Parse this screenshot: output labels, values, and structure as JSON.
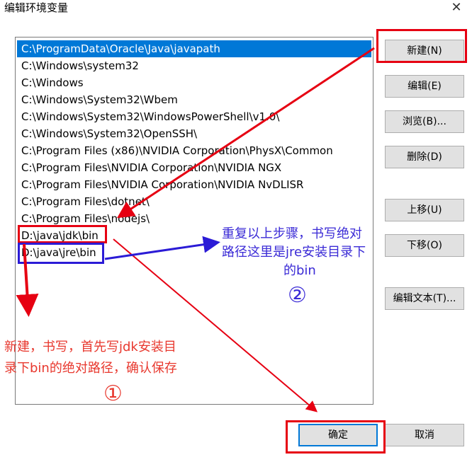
{
  "window": {
    "title": "编辑环境变量",
    "close_glyph": "✕"
  },
  "paths": [
    "C:\\ProgramData\\Oracle\\Java\\javapath",
    "C:\\Windows\\system32",
    "C:\\Windows",
    "C:\\Windows\\System32\\Wbem",
    "C:\\Windows\\System32\\WindowsPowerShell\\v1.0\\",
    "C:\\Windows\\System32\\OpenSSH\\",
    "C:\\Program Files (x86)\\NVIDIA Corporation\\PhysX\\Common",
    "C:\\Program Files\\NVIDIA Corporation\\NVIDIA NGX",
    "C:\\Program Files\\NVIDIA Corporation\\NVIDIA NvDLISR",
    "C:\\Program Files\\dotnet\\",
    "C:\\Program Files\\nodejs\\",
    "D:\\java\\jdk\\bin",
    "D:\\java\\jre\\bin"
  ],
  "selected_index": 0,
  "buttons": {
    "new": "新建(N)",
    "edit": "编辑(E)",
    "browse": "浏览(B)...",
    "delete": "删除(D)",
    "move_up": "上移(U)",
    "move_down": "下移(O)",
    "edit_text": "编辑文本(T)...",
    "ok": "确定",
    "cancel": "取消"
  },
  "annotations": {
    "step1_text_line1": "新建，书写，首先写jdk安装目",
    "step1_text_line2": "录下bin的绝对路径，确认保存",
    "step1_marker": "①",
    "step2_text_line1": "重复以上步骤，书写绝对",
    "step2_text_line2": "路径这里是jre安装目录下",
    "step2_text_line3": "的bin",
    "step2_marker": "②"
  },
  "colors": {
    "annotation_red": "#e60012",
    "annotation_blue": "#2b1bd6",
    "selection": "#0078d7"
  }
}
